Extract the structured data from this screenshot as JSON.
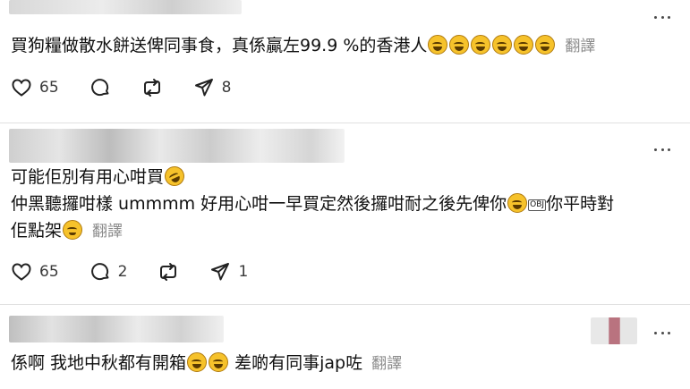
{
  "posts": [
    {
      "lines": [
        "買狗糧做散水餅送俾同事食，真係贏左99.9 %的香港人"
      ],
      "translate": "翻譯",
      "likes": "65",
      "reposts": "",
      "comments": "",
      "shares": "8"
    },
    {
      "lines": [
        "可能佢別有用心咁買",
        "仲黑聽攞咁樣 ummmm 好用心咁一早買定然後攞咁耐之後先俾你",
        "你平時對",
        "佢點架"
      ],
      "translate": "翻譯",
      "likes": "65",
      "comments": "2",
      "reposts": "",
      "shares": "1"
    },
    {
      "lines": [
        "係啊 我地中秋都有開箱",
        "差啲有同事jap咗"
      ],
      "translate": "翻譯"
    }
  ],
  "badge": "OBJ",
  "icons": [
    "heart-icon",
    "comment-icon",
    "repost-icon",
    "share-icon",
    "more-icon",
    "laughing-emoji",
    "rofl-emoji",
    "pensive-emoji",
    "wink-emoji"
  ]
}
